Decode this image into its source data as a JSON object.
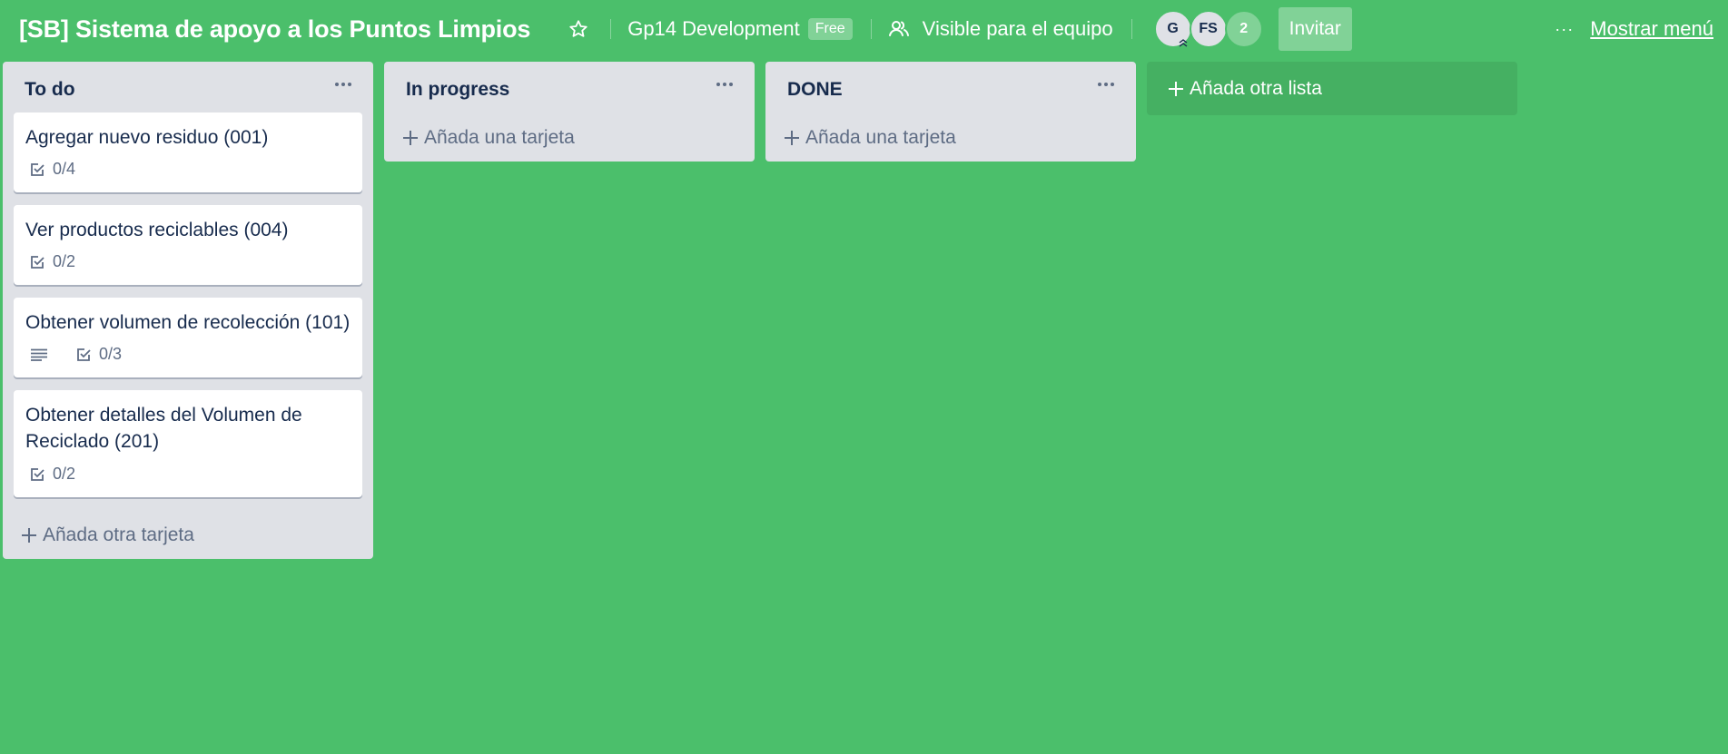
{
  "board": {
    "title": "[SB] Sistema de apoyo a los Puntos Limpios",
    "team_name": "Gp14 Development",
    "plan_badge": "Free",
    "visibility_label": "Visible para el equipo",
    "members": [
      {
        "initials": "G"
      },
      {
        "initials": "FS"
      }
    ],
    "extra_members": "2",
    "invite_label": "Invitar",
    "show_menu_label": "Mostrar menú",
    "menu_dots": "···",
    "background_color": "#4bbf6b"
  },
  "lists": [
    {
      "title": "To do",
      "add_card_label": "Añada otra tarjeta",
      "cards": [
        {
          "title": "Agregar nuevo residuo (001)",
          "checklist": "0/4",
          "has_description": false
        },
        {
          "title": "Ver productos reciclables (004)",
          "checklist": "0/2",
          "has_description": false
        },
        {
          "title": "Obtener volumen de recolección (101)",
          "checklist": "0/3",
          "has_description": true
        },
        {
          "title": "Obtener detalles del Volumen de Reciclado (201)",
          "checklist": "0/2",
          "has_description": false
        }
      ]
    },
    {
      "title": "In progress",
      "add_card_label": "Añada una tarjeta",
      "cards": []
    },
    {
      "title": "DONE",
      "add_card_label": "Añada una tarjeta",
      "cards": []
    }
  ],
  "add_list_label": "Añada otra lista",
  "icons": {
    "star": "star-icon",
    "visibility": "team-visibility-icon",
    "checklist": "checklist-icon",
    "description": "description-icon",
    "plus": "plus-icon",
    "more": "more-icon"
  }
}
